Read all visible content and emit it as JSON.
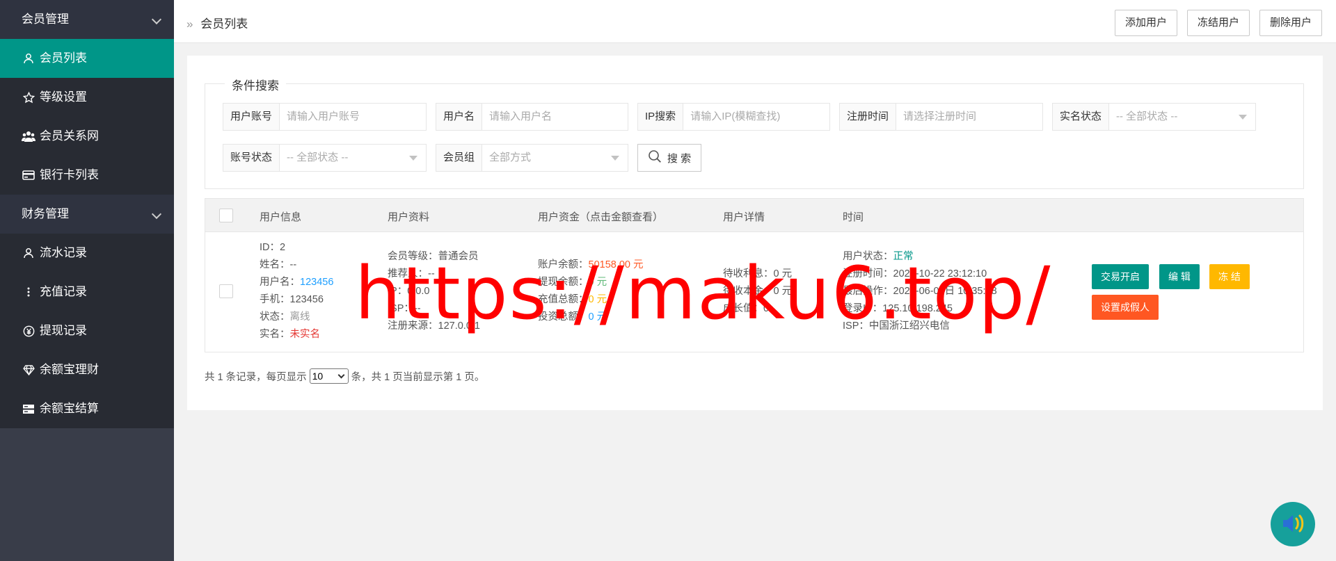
{
  "sidebar": {
    "groups": [
      {
        "title": "会员管理",
        "items": [
          {
            "label": "会员列表",
            "icon": "user-icon"
          },
          {
            "label": "等级设置",
            "icon": "star-icon"
          },
          {
            "label": "会员关系网",
            "icon": "users-icon"
          },
          {
            "label": "银行卡列表",
            "icon": "credit-card-icon"
          }
        ]
      },
      {
        "title": "财务管理",
        "items": [
          {
            "label": "流水记录",
            "icon": "user-icon"
          },
          {
            "label": "充值记录",
            "icon": "more-vertical-icon"
          },
          {
            "label": "提现记录",
            "icon": "yen-icon"
          },
          {
            "label": "余额宝理财",
            "icon": "diamond-icon"
          },
          {
            "label": "余额宝结算",
            "icon": "server-icon"
          }
        ]
      }
    ]
  },
  "header": {
    "breadcrumb": "会员列表",
    "buttons": {
      "add": "添加用户",
      "freeze": "冻结用户",
      "delete": "删除用户"
    }
  },
  "search": {
    "legend": "条件搜索",
    "fields": {
      "account": {
        "label": "用户账号",
        "placeholder": "请输入用户账号"
      },
      "username": {
        "label": "用户名",
        "placeholder": "请输入用户名"
      },
      "ip": {
        "label": "IP搜索",
        "placeholder": "请输入IP(模糊查找)"
      },
      "regtime": {
        "label": "注册时间",
        "placeholder": "请选择注册时间"
      },
      "realname_status": {
        "label": "实名状态",
        "value": "-- 全部状态 --"
      },
      "account_status": {
        "label": "账号状态",
        "value": "-- 全部状态 --"
      },
      "group": {
        "label": "会员组",
        "value": "全部方式"
      }
    },
    "button": "搜 索"
  },
  "table": {
    "headers": [
      "用户信息",
      "用户资料",
      "用户资金（点击金额查看）",
      "用户详情",
      "时间"
    ],
    "row": {
      "info": {
        "id_label": "ID：",
        "id": "2",
        "name_label": "姓名：",
        "name": "--",
        "username_label": "用户名：",
        "username": "123456",
        "phone_label": "手机：",
        "phone": "123456",
        "status_label": "状态：",
        "status": "离线",
        "realname_label": "实名：",
        "realname": "未实名"
      },
      "profile": {
        "level_label": "会员等级：",
        "level": "普通会员",
        "referrer_label": "推荐人：",
        "referrer": "--",
        "ip_label": "IP：",
        "ip": "0.0.0",
        "isp_label": "ISP：",
        "isp": "--",
        "source_label": "注册来源：",
        "source": "127.0.0.1"
      },
      "funds": {
        "balance_label": "账户余额：",
        "balance": "50158.00 元",
        "withdraw_label": "提现余额：",
        "withdraw": "0 元",
        "recharge_label": "充值总额：",
        "recharge": "0 元",
        "invest_label": "投资总额：",
        "invest": "0 元"
      },
      "details": {
        "interest_label": "待收利息：",
        "interest": "0 元",
        "principal_label": "待收本金：",
        "principal": "0 元",
        "growth_label": "成长值：",
        "growth": "0"
      },
      "time": {
        "user_status_label": "用户状态：",
        "user_status": "正常",
        "reg_label": "注册时间：",
        "reg": "2022-10-22 23:12:10",
        "last_label": "最后操作：",
        "last": "2024-06-07日 10:35:08",
        "login_ip_label": "登录IP：",
        "login_ip": "125.10.198.245",
        "isp_label": "ISP：",
        "isp": "中国浙江绍兴电信"
      },
      "actions": {
        "trade": "交易开启",
        "edit": "编 辑",
        "freeze": "冻 结",
        "fake": "设置成假人"
      }
    }
  },
  "pagination": {
    "prefix": "共 1 条记录，每页显示",
    "per_page": "10",
    "suffix": "条，共 1 页当前显示第 1 页。"
  },
  "watermark": "https://maku6.top/",
  "colors": {
    "sidebar": "#393d49",
    "active": "#009688",
    "danger": "#ff5722",
    "warn": "#ffb800"
  }
}
